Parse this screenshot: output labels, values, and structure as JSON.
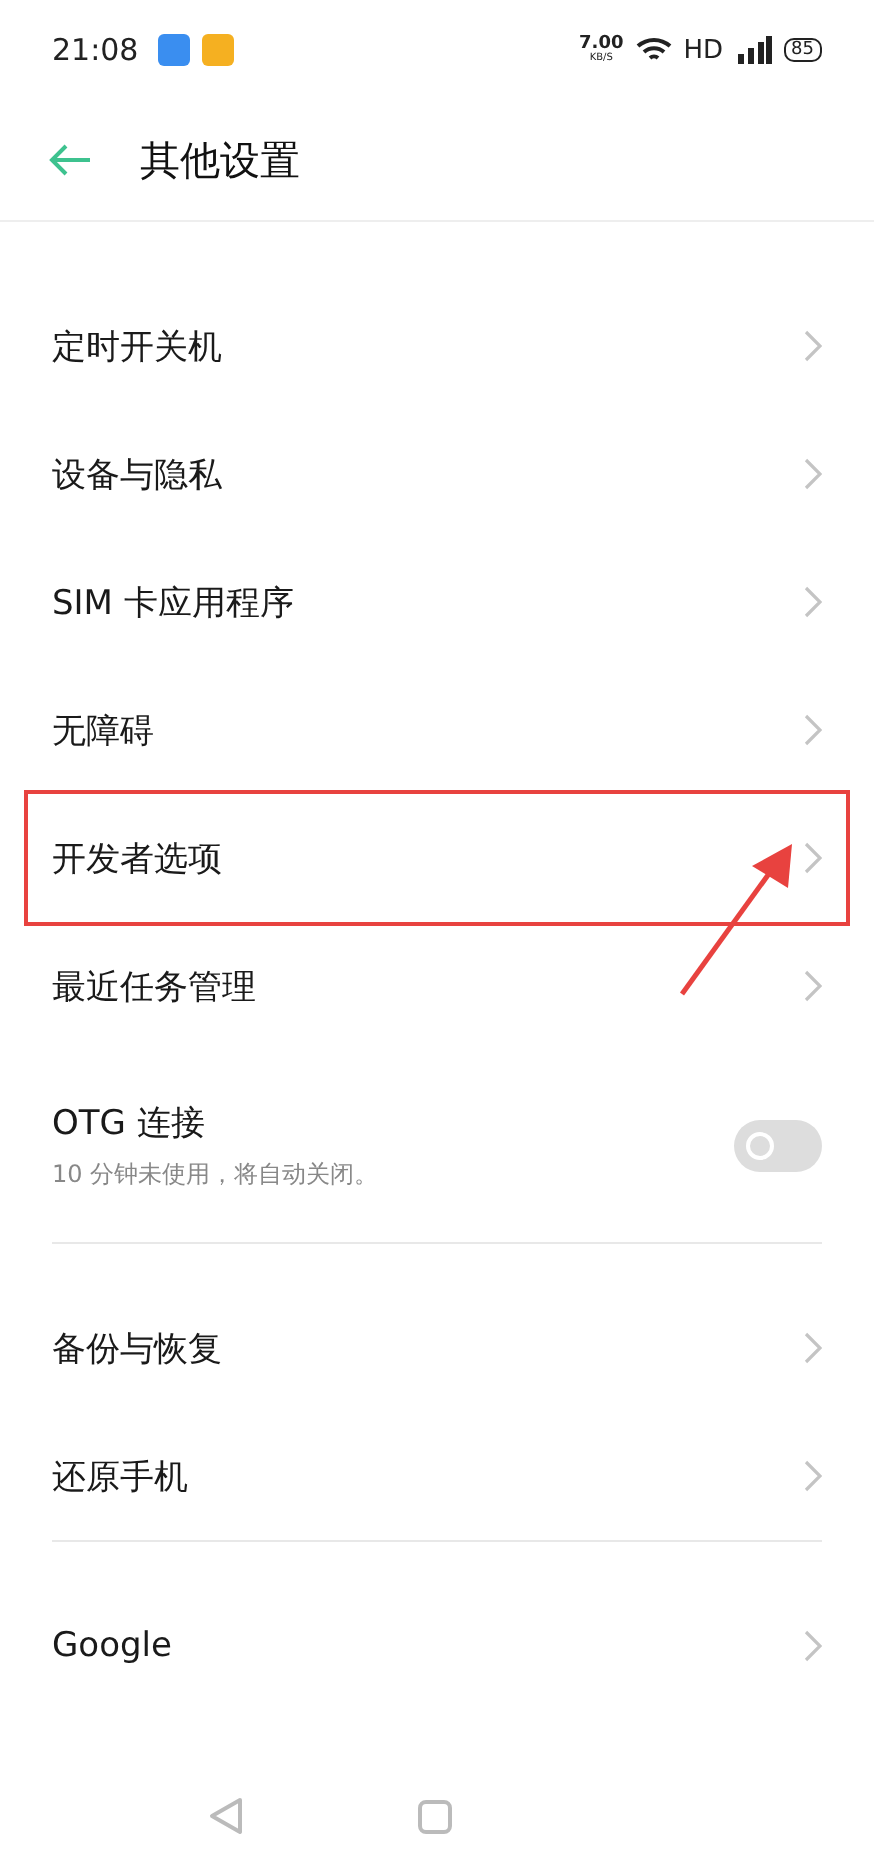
{
  "status_bar": {
    "time": "21:08",
    "speed": "7.00",
    "speed_unit": "KB/S",
    "network": "HD",
    "battery": "85"
  },
  "header": {
    "title": "其他设置"
  },
  "groups": [
    {
      "items": [
        {
          "kind": "link",
          "label": "定时开关机",
          "highlighted": false
        },
        {
          "kind": "link",
          "label": "设备与隐私",
          "highlighted": false
        },
        {
          "kind": "link",
          "label": "SIM 卡应用程序",
          "highlighted": false
        },
        {
          "kind": "link",
          "label": "无障碍",
          "highlighted": false
        },
        {
          "kind": "link",
          "label": "开发者选项",
          "highlighted": true
        },
        {
          "kind": "link",
          "label": "最近任务管理",
          "highlighted": false
        },
        {
          "kind": "switch",
          "label": "OTG 连接",
          "subtitle": "10 分钟未使用，将自动关闭。",
          "on": false
        }
      ]
    },
    {
      "items": [
        {
          "kind": "link",
          "label": "备份与恢复",
          "highlighted": false
        },
        {
          "kind": "link",
          "label": "还原手机",
          "highlighted": false
        }
      ]
    },
    {
      "items": [
        {
          "kind": "link",
          "label": "Google",
          "highlighted": false
        }
      ]
    }
  ]
}
